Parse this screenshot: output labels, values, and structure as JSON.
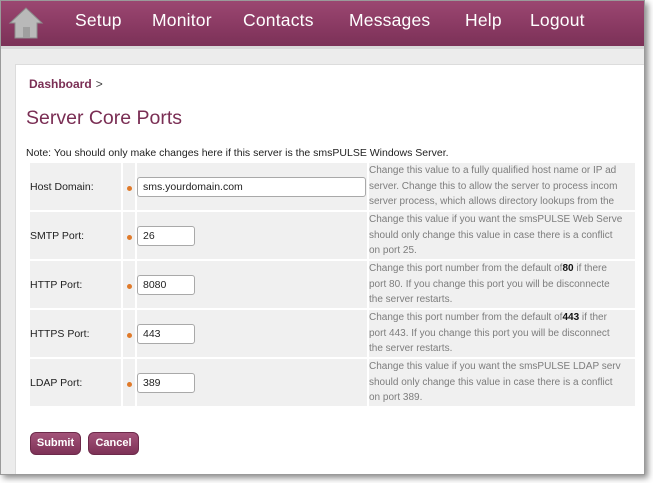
{
  "nav": {
    "home_icon": "home-icon",
    "items": [
      "Setup",
      "Monitor",
      "Contacts",
      "Messages",
      "Help",
      "Logout"
    ]
  },
  "breadcrumb": {
    "link": "Dashboard",
    "separator": ">"
  },
  "page": {
    "title": "Server Core Ports",
    "note": "Note: You should only make changes here if this server is the smsPULSE Windows Server."
  },
  "fields": [
    {
      "label": "Host Domain:",
      "value": "sms.yourdomain.com",
      "desc": [
        [
          "Change this value to a fully qualified host name or IP ad"
        ],
        [
          "server. Change this to allow the server to process incom"
        ],
        [
          "server process, which allows directory lookups from the"
        ]
      ]
    },
    {
      "label": "SMTP Port:",
      "value": "26",
      "desc": [
        [
          "Change this value if you want the smsPULSE Web Serve"
        ],
        [
          "should only change this value in case there is a conflict"
        ],
        [
          "on port 25."
        ]
      ]
    },
    {
      "label": "HTTP Port:",
      "value": "8080",
      "desc": [
        [
          "Change this port number from the default of",
          "80",
          " if there"
        ],
        [
          "port 80. If you change this port you will be disconnecte"
        ],
        [
          "the server restarts."
        ]
      ]
    },
    {
      "label": "HTTPS Port:",
      "value": "443",
      "desc": [
        [
          "Change this port number from the default of",
          "443",
          " if ther"
        ],
        [
          "port 443. If you change this port you will be disconnect"
        ],
        [
          "the server restarts."
        ]
      ]
    },
    {
      "label": "LDAP Port:",
      "value": "389",
      "desc": [
        [
          "Change this value if you want the smsPULSE LDAP serv"
        ],
        [
          "should only change this value in case there is a conflict"
        ],
        [
          "on port 389."
        ]
      ]
    }
  ],
  "buttons": {
    "submit": "Submit",
    "cancel": "Cancel"
  },
  "colors": {
    "nav_bg": "#8a3a63",
    "accent": "#7a2e54",
    "required_dot": "#e07a2a"
  }
}
